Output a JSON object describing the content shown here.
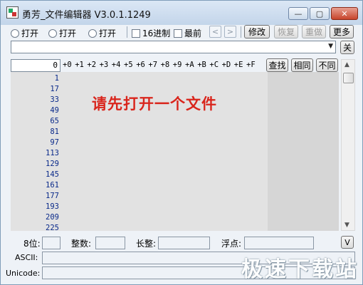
{
  "window": {
    "title": "勇芳_文件编辑器 V3.0.1.1249",
    "controls": {
      "minimize": "—",
      "maximize": "▢",
      "close": "✕"
    }
  },
  "toolbar": {
    "radios": [
      "打开",
      "打开",
      "打开"
    ],
    "checkbox_16": "16进制",
    "checkbox_recent": "最前",
    "prev": "<",
    "next": ">",
    "modify": "修改",
    "restore": "恢复",
    "redo": "重做",
    "more": "更多"
  },
  "path_combo": {
    "value": ""
  },
  "close_btn": "关",
  "offset_input": "0",
  "column_headers": [
    "+0",
    "+1",
    "+2",
    "+3",
    "+4",
    "+5",
    "+6",
    "+7",
    "+8",
    "+9",
    "+A",
    "+B",
    "+C",
    "+D",
    "+E",
    "+F"
  ],
  "search": {
    "find": "查找",
    "same": "相同",
    "diff": "不同"
  },
  "row_offsets": [
    "1",
    "17",
    "33",
    "49",
    "65",
    "81",
    "97",
    "113",
    "129",
    "145",
    "161",
    "177",
    "193",
    "209",
    "225"
  ],
  "overlay_message": "请先打开一个文件",
  "bottom": {
    "bit8": "8位:",
    "integer": "整数:",
    "long_int": "长整:",
    "float": "浮点:",
    "toggle": "V",
    "ascii": "ASCII:",
    "unicode": "Unicode:"
  },
  "watermark": "极速下载站"
}
